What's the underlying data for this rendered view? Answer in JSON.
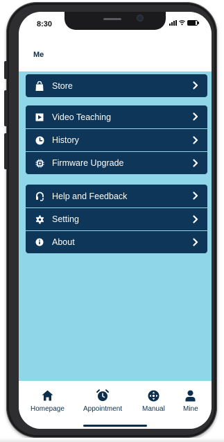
{
  "status_bar": {
    "time": "8:30"
  },
  "header": {
    "title": "Me"
  },
  "menu": {
    "groups": [
      {
        "items": [
          {
            "label": "Store",
            "icon": "store-bag-icon"
          }
        ]
      },
      {
        "items": [
          {
            "label": "Video Teaching",
            "icon": "play-video-icon"
          },
          {
            "label": "History",
            "icon": "clock-icon"
          },
          {
            "label": "Firmware Upgrade",
            "icon": "chip-icon"
          }
        ]
      },
      {
        "items": [
          {
            "label": "Help and Feedback",
            "icon": "headset-icon"
          },
          {
            "label": "Setting",
            "icon": "gear-icon"
          },
          {
            "label": "About",
            "icon": "info-icon"
          }
        ]
      }
    ]
  },
  "tabbar": {
    "tabs": [
      {
        "label": "Homepage",
        "icon": "home-icon"
      },
      {
        "label": "Appointment",
        "icon": "alarm-clock-icon"
      },
      {
        "label": "Manual",
        "icon": "dpad-icon"
      },
      {
        "label": "Mine",
        "icon": "user-icon"
      }
    ]
  },
  "colors": {
    "menu_background": "#0d3659",
    "content_background": "#8fd6e8",
    "text_dark": "#0d2f4d"
  }
}
